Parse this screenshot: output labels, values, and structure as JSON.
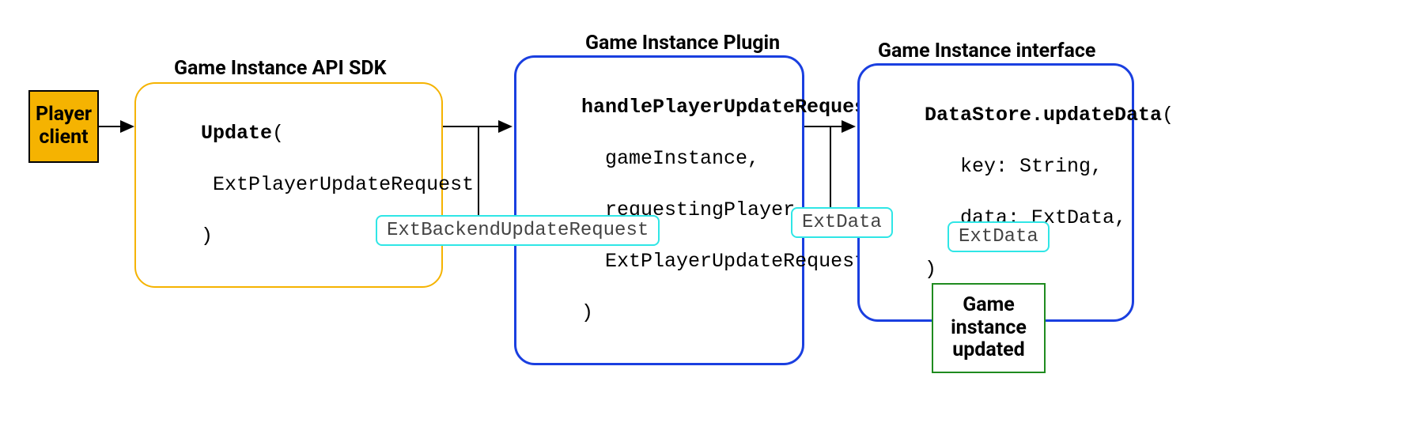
{
  "player": {
    "label": "Player\nclient"
  },
  "sdk": {
    "title": "Game Instance API SDK",
    "fn": "Update",
    "params": [
      "ExtPlayerUpdateRequest"
    ]
  },
  "plugin": {
    "title": "Game Instance Plugin",
    "fn": "handlePlayerUpdateRequest",
    "params": [
      "gameInstance,",
      "requestingPlayer",
      "ExtPlayerUpdateRequest"
    ]
  },
  "iface": {
    "title": "Game Instance interface",
    "fn": "DataStore.updateData",
    "params": [
      "key: String,",
      "data: ExtData,"
    ]
  },
  "tags": {
    "sdk_to_plugin": "ExtBackendUpdateRequest",
    "plugin_to_iface": "ExtData",
    "iface_out": "ExtData"
  },
  "result": {
    "label": "Game\ninstance\nupdated"
  }
}
